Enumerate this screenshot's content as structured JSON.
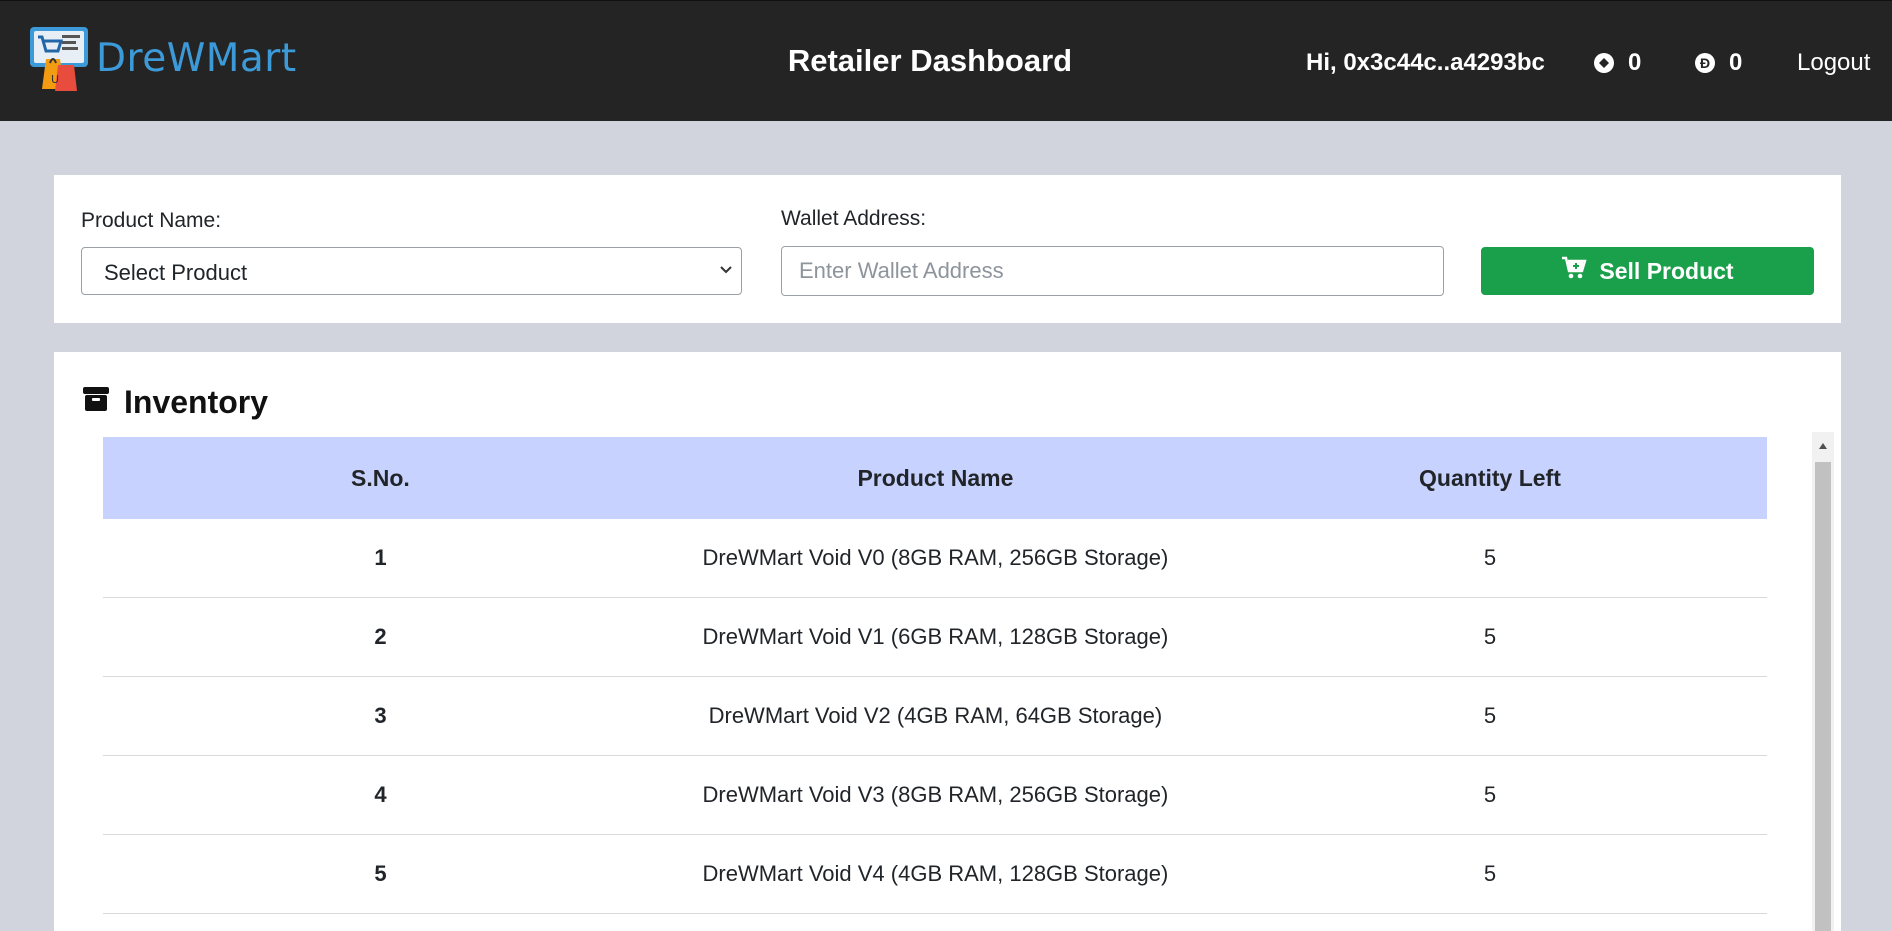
{
  "header": {
    "logo_text": "DreWMart",
    "title": "Retailer Dashboard",
    "greeting": "Hi, 0x3c44c..a4293bc",
    "balance_1": "0",
    "balance_2": "0",
    "coin_2_symbol": "Đ",
    "logout_label": "Logout"
  },
  "form": {
    "product_label": "Product Name:",
    "product_selected": "Select Product",
    "wallet_label": "Wallet Address:",
    "wallet_placeholder": "Enter Wallet Address",
    "wallet_value": "",
    "sell_button_label": "Sell Product",
    "sell_button_color": "#1a9f4a"
  },
  "inventory": {
    "title": "Inventory",
    "columns": [
      "S.No.",
      "Product Name",
      "Quantity Left"
    ],
    "rows": [
      {
        "sno": "1",
        "name": "DreWMart Void V0 (8GB RAM, 256GB Storage)",
        "qty": "5"
      },
      {
        "sno": "2",
        "name": "DreWMart Void V1 (6GB RAM, 128GB Storage)",
        "qty": "5"
      },
      {
        "sno": "3",
        "name": "DreWMart Void V2 (4GB RAM, 64GB Storage)",
        "qty": "5"
      },
      {
        "sno": "4",
        "name": "DreWMart Void V3 (8GB RAM, 256GB Storage)",
        "qty": "5"
      },
      {
        "sno": "5",
        "name": "DreWMart Void V4 (4GB RAM, 128GB Storage)",
        "qty": "5"
      }
    ]
  },
  "icons": {
    "logo": "shopping-cart-bag-logo-icon",
    "coin_1": "circle-coin-icon",
    "coin_2": "dogecoin-icon",
    "select_caret": "chevron-down-icon",
    "sell": "cart-plus-icon",
    "inventory": "archive-box-icon",
    "scroll_up": "scroll-up-arrow-icon"
  },
  "colors": {
    "topbar": "#242424",
    "page_bg": "#d1d4dc",
    "table_header": "#c7d2fe",
    "logo_text": "#3d9ad9"
  }
}
